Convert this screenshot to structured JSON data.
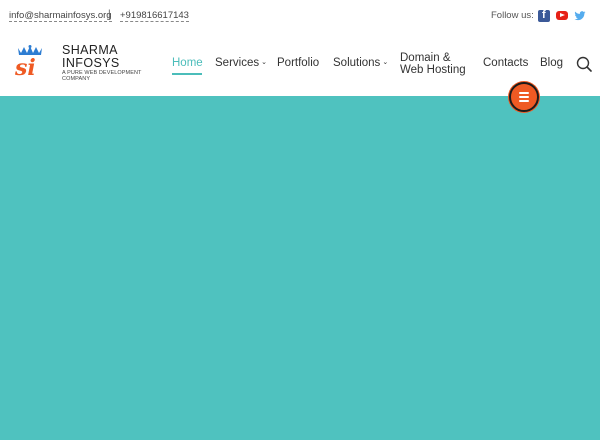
{
  "topbar": {
    "email": "info@sharmainfosys.org",
    "separator": "|",
    "phone": "+919816617143",
    "follow_label": "Follow us:",
    "social": [
      "facebook-icon",
      "youtube-icon",
      "twitter-icon"
    ]
  },
  "brand": {
    "name_line1": "SHARMA",
    "name_line2": "INFOSYS",
    "tagline_line1": "A PURE WEB DEVELOPMENT",
    "tagline_line2": "COMPANY",
    "logo_text": "si"
  },
  "nav": {
    "items": [
      {
        "label": "Home",
        "active": true
      },
      {
        "label": "Services",
        "has_caret": true
      },
      {
        "label": "Portfolio"
      },
      {
        "label": "Solutions",
        "has_caret": true
      },
      {
        "label_line1": "Domain &",
        "label_line2": "Web Hosting"
      },
      {
        "label": "Contacts"
      },
      {
        "label": "Blog"
      }
    ],
    "caret": "⌄"
  },
  "colors": {
    "accent": "#4bbdba",
    "hero_bg": "#4fc2bf",
    "fab": "#ef5a23",
    "facebook": "#3b5998",
    "youtube": "#e62117",
    "twitter": "#55acee"
  }
}
